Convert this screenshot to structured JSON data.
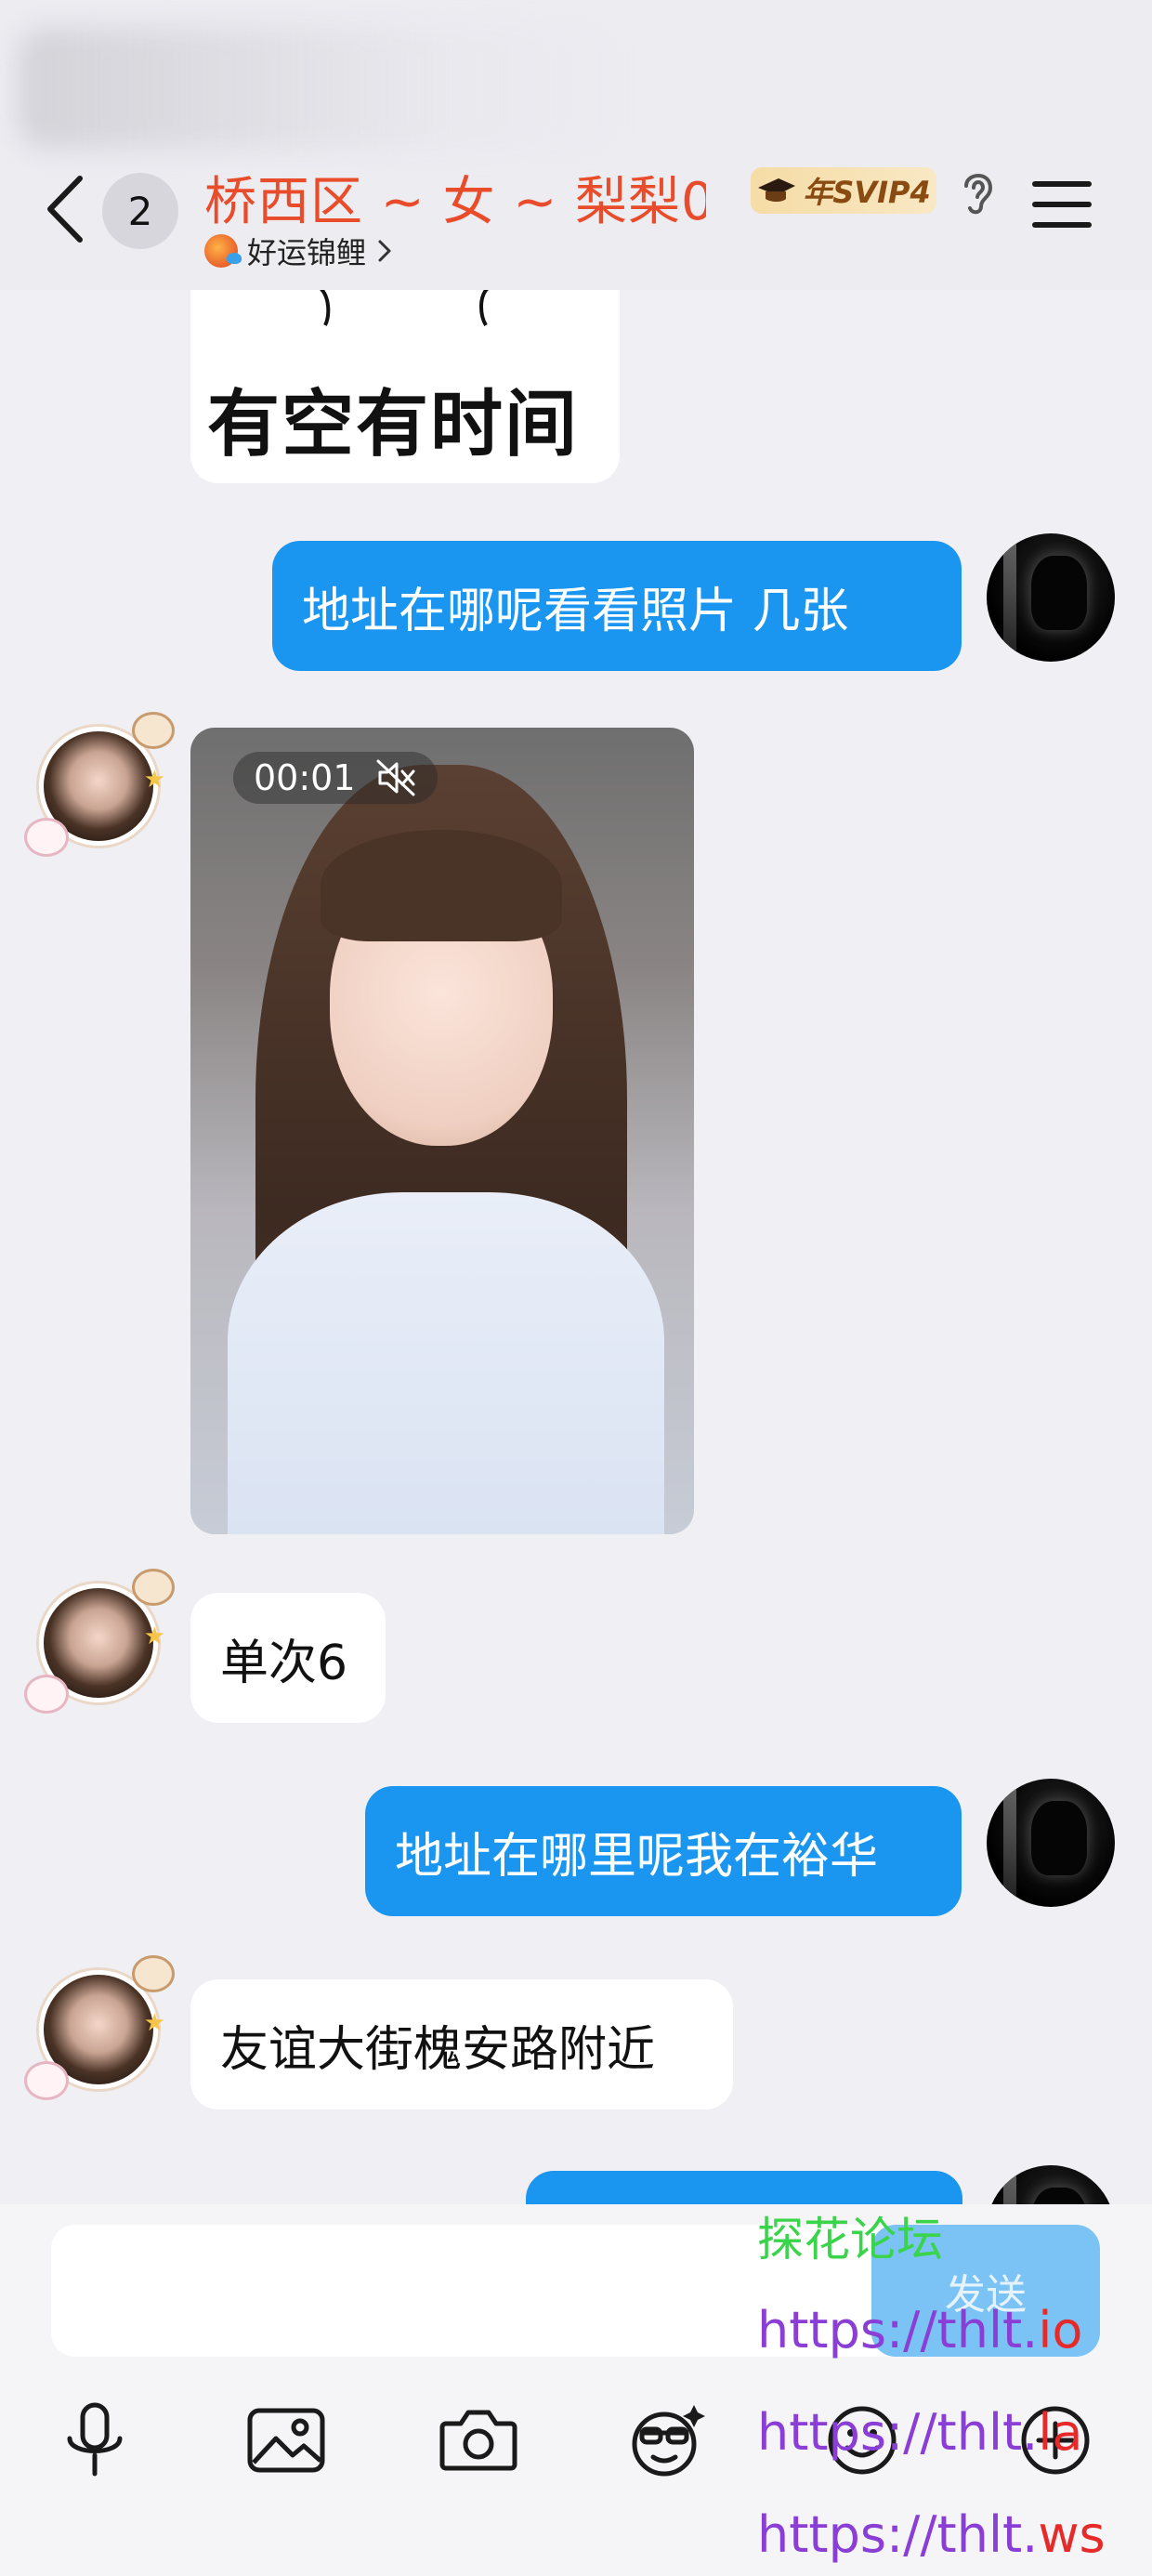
{
  "header": {
    "unread_count": "2",
    "title": "桥西区 ~ 女 ~ 梨梨0...",
    "subtitle": "好运锦鲤",
    "vip_badge": "年SVIP4",
    "colors": {
      "title": "#e94c2a",
      "vip_text": "#8a4b12"
    }
  },
  "messages": [
    {
      "type": "sticker",
      "direction": "in",
      "text": "有空有时间"
    },
    {
      "type": "text",
      "direction": "out",
      "text": "地址在哪呢看看照片  几张"
    },
    {
      "type": "video",
      "direction": "in",
      "duration": "00:01",
      "muted": true
    },
    {
      "type": "text",
      "direction": "in",
      "text": "单次6"
    },
    {
      "type": "text",
      "direction": "out",
      "text": "地址在哪里呢我在裕华"
    },
    {
      "type": "text",
      "direction": "in",
      "text": "友谊大街槐安路附近"
    }
  ],
  "input": {
    "placeholder": "",
    "send_label": "发送"
  },
  "toolbar": [
    "microphone-icon",
    "image-icon",
    "camera-icon",
    "sticker-icon",
    "emoji-icon",
    "plus-icon"
  ],
  "watermark": {
    "title": "探花论坛",
    "line1_a": "https://thlt.",
    "line1_b": "io",
    "line2_a": "https://thlt.",
    "line2_b": "la",
    "line3_a": "https://thlt.",
    "line3_b": "ws"
  },
  "colors": {
    "bubble_out": "#1a95f0",
    "background": "#efeff4"
  }
}
